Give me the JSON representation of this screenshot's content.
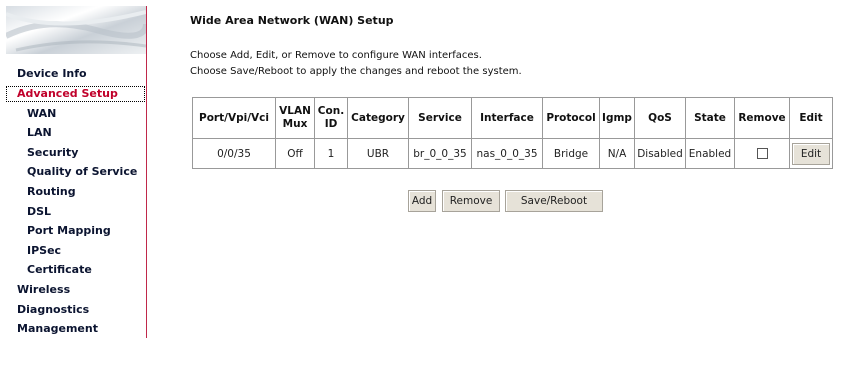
{
  "sidebar": {
    "items": [
      {
        "label": "Device Info",
        "level": 0,
        "active": false
      },
      {
        "label": "Advanced Setup",
        "level": 0,
        "active": true
      },
      {
        "label": "WAN",
        "level": 1,
        "active": false
      },
      {
        "label": "LAN",
        "level": 1,
        "active": false
      },
      {
        "label": "Security",
        "level": 1,
        "active": false
      },
      {
        "label": "Quality of Service",
        "level": 1,
        "active": false
      },
      {
        "label": "Routing",
        "level": 1,
        "active": false
      },
      {
        "label": "DSL",
        "level": 1,
        "active": false
      },
      {
        "label": "Port Mapping",
        "level": 1,
        "active": false
      },
      {
        "label": "IPSec",
        "level": 1,
        "active": false
      },
      {
        "label": "Certificate",
        "level": 1,
        "active": false
      },
      {
        "label": "Wireless",
        "level": 0,
        "active": false
      },
      {
        "label": "Diagnostics",
        "level": 0,
        "active": false
      },
      {
        "label": "Management",
        "level": 0,
        "active": false
      }
    ]
  },
  "main": {
    "title": "Wide Area Network (WAN) Setup",
    "desc1": "Choose Add, Edit, or Remove to configure WAN interfaces.",
    "desc2": "Choose Save/Reboot to apply the changes and reboot the system."
  },
  "table": {
    "headers": [
      [
        "Port/Vpi/Vci"
      ],
      [
        "VLAN",
        "Mux"
      ],
      [
        "Con.",
        "ID"
      ],
      [
        "Category"
      ],
      [
        "Service"
      ],
      [
        "Interface"
      ],
      [
        "Protocol"
      ],
      [
        "Igmp"
      ],
      [
        "QoS"
      ],
      [
        "State"
      ],
      [
        "Remove"
      ],
      [
        "Edit"
      ]
    ],
    "rows": [
      {
        "port": "0/0/35",
        "vlan_mux": "Off",
        "con_id": "1",
        "category": "UBR",
        "service": "br_0_0_35",
        "interface": "nas_0_0_35",
        "protocol": "Bridge",
        "igmp": "N/A",
        "qos": "Disabled",
        "state": "Enabled",
        "remove_checked": false,
        "edit_label": "Edit"
      }
    ]
  },
  "buttons": {
    "add": "Add",
    "remove": "Remove",
    "save_reboot": "Save/Reboot"
  },
  "colors": {
    "active_menu": "#c0002a",
    "sidebar_border": "#c0284a",
    "button_bg": "#e6e2d8"
  }
}
